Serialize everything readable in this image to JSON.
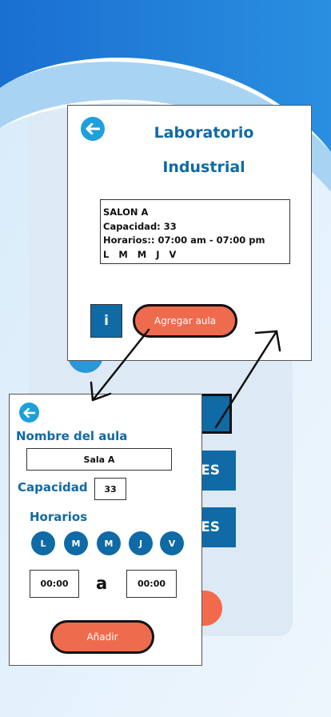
{
  "top_card": {
    "title_line1": "Laboratorio",
    "title_line2": "Industrial",
    "info": {
      "name": "SALON A",
      "capacity": "Capacidad: 33",
      "hours": "Horarios:: 07:00 am - 07:00 pm",
      "days": "L   M   M   J   V"
    },
    "info_button": "i",
    "add_button": "Agregar aula"
  },
  "bottom_card": {
    "name_label": "Nombre del aula",
    "name_value": "Sala A",
    "capacity_label": "Capacidad",
    "capacity_value": "33",
    "schedule_label": "Horarios",
    "days": [
      "L",
      "M",
      "M",
      "J",
      "V"
    ],
    "start_time": "00:00",
    "separator": "a",
    "end_time": "00:00",
    "add_button": "Añadir"
  },
  "background": {
    "button1_text": "ES",
    "button2_text": "ES"
  },
  "colors": {
    "primary": "#0f6aa5",
    "accent": "#ef6b4d",
    "back_icon": "#1ea0dd"
  }
}
